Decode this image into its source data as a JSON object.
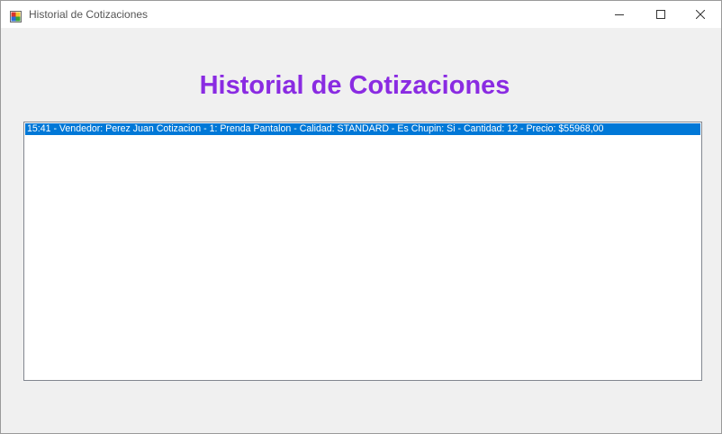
{
  "window": {
    "title": "Historial de Cotizaciones"
  },
  "caption_buttons": {
    "minimize_icon": "minimize-icon",
    "maximize_icon": "maximize-icon",
    "close_icon": "close-icon"
  },
  "main": {
    "heading": "Historial de Cotizaciones",
    "heading_color": "#8a2be2",
    "list": {
      "items": [
        {
          "text": "15:41 - Vendedor: Perez Juan Cotizacion - 1: Prenda Pantalon - Calidad: STANDARD - Es Chupin: Si - Cantidad: 12 - Precio: $55968,00",
          "selected": true
        }
      ],
      "selection_color": "#0078d7"
    }
  }
}
